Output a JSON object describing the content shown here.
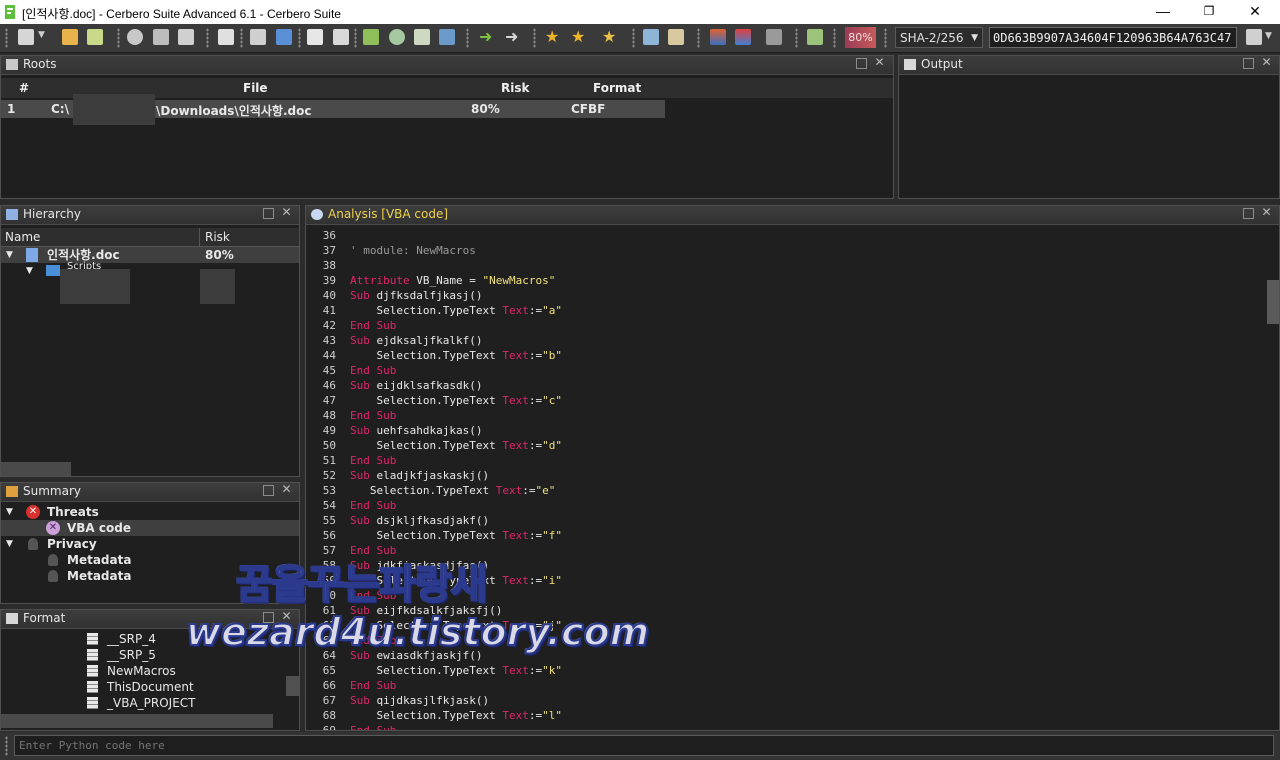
{
  "window": {
    "title": "[인적사항.doc] - Cerbero Suite Advanced 6.1 - Cerbero Suite",
    "minimize": "—",
    "restore": "❐",
    "close": "✕"
  },
  "toolbar": {
    "risk_badge": "80%",
    "hash_algo": "SHA-2/256",
    "hash_value": "0D663B9907A34604F120963B64A763C47"
  },
  "roots": {
    "title": "Roots",
    "columns": [
      "#",
      "File",
      "Risk",
      "Format"
    ],
    "rows": [
      {
        "num": "1",
        "file_prefix": "C:\\",
        "file_suffix": "\\Downloads\\인적사항.doc",
        "risk": "80%",
        "format": "CFBF"
      }
    ]
  },
  "output": {
    "title": "Output"
  },
  "hierarchy": {
    "title": "Hierarchy",
    "columns": [
      "Name",
      "Risk"
    ],
    "rows": [
      {
        "name": "인적사항.doc",
        "risk": "80%"
      },
      {
        "name": "Scripts",
        "risk": ""
      }
    ]
  },
  "summary": {
    "title": "Summary",
    "items": [
      {
        "label": "Threats"
      },
      {
        "label": "VBA code"
      },
      {
        "label": "Privacy"
      },
      {
        "label": "Metadata"
      },
      {
        "label": "Metadata"
      }
    ]
  },
  "format": {
    "title": "Format",
    "items": [
      "__SRP_4",
      "__SRP_5",
      "NewMacros",
      "ThisDocument",
      "_VBA_PROJECT"
    ]
  },
  "analysis": {
    "title": "Analysis [VBA code]",
    "lines": [
      {
        "n": "36",
        "t": ""
      },
      {
        "n": "37",
        "t": "' module: NewMacros"
      },
      {
        "n": "38",
        "t": ""
      },
      {
        "n": "39",
        "t": "Attribute VB_Name = \"NewMacros\""
      },
      {
        "n": "40",
        "t": "Sub djfksdalfjkasj()"
      },
      {
        "n": "41",
        "t": "    Selection.TypeText Text:=\"a\""
      },
      {
        "n": "42",
        "t": "End Sub"
      },
      {
        "n": "43",
        "t": "Sub ejdksaljfkalkf()"
      },
      {
        "n": "44",
        "t": "    Selection.TypeText Text:=\"b\""
      },
      {
        "n": "45",
        "t": "End Sub"
      },
      {
        "n": "46",
        "t": "Sub eijdklsafkasdk()"
      },
      {
        "n": "47",
        "t": "    Selection.TypeText Text:=\"c\""
      },
      {
        "n": "48",
        "t": "End Sub"
      },
      {
        "n": "49",
        "t": "Sub uehfsahdkajkas()"
      },
      {
        "n": "50",
        "t": "    Selection.TypeText Text:=\"d\""
      },
      {
        "n": "51",
        "t": "End Sub"
      },
      {
        "n": "52",
        "t": "Sub eladjkfjaskaskj()"
      },
      {
        "n": "53",
        "t": "   Selection.TypeText Text:=\"e\""
      },
      {
        "n": "54",
        "t": "End Sub"
      },
      {
        "n": "55",
        "t": "Sub dsjkljfkasdjakf()"
      },
      {
        "n": "56",
        "t": "    Selection.TypeText Text:=\"f\""
      },
      {
        "n": "57",
        "t": "End Sub"
      },
      {
        "n": "58",
        "t": "Sub jdkfjaskasdjfas()"
      },
      {
        "n": "59",
        "t": "    Selection.TypeText Text:=\"i\""
      },
      {
        "n": "60",
        "t": "End Sub"
      },
      {
        "n": "61",
        "t": "Sub eijfkdsalkfjaksfj()"
      },
      {
        "n": "62",
        "t": "    Selection.TypeText Text:=\"j\""
      },
      {
        "n": "63",
        "t": "End Sub"
      },
      {
        "n": "64",
        "t": "Sub ewiasdkfjaskjf()"
      },
      {
        "n": "65",
        "t": "    Selection.TypeText Text:=\"k\""
      },
      {
        "n": "66",
        "t": "End Sub"
      },
      {
        "n": "67",
        "t": "Sub qijdkasjlfkjask()"
      },
      {
        "n": "68",
        "t": "    Selection.TypeText Text:=\"l\""
      },
      {
        "n": "69",
        "t": "End Sub"
      }
    ]
  },
  "python": {
    "placeholder": "Enter Python code here"
  },
  "watermark": {
    "line1": "꿈을꾸는파랑새",
    "line2": "wezard4u.tistory.com"
  },
  "colors": {
    "keyword": "#e0256a",
    "string": "#f1e27a",
    "comment": "#9a9a9a",
    "accent_title": "#f0d24a",
    "risk_badge": "#9c3d56"
  }
}
